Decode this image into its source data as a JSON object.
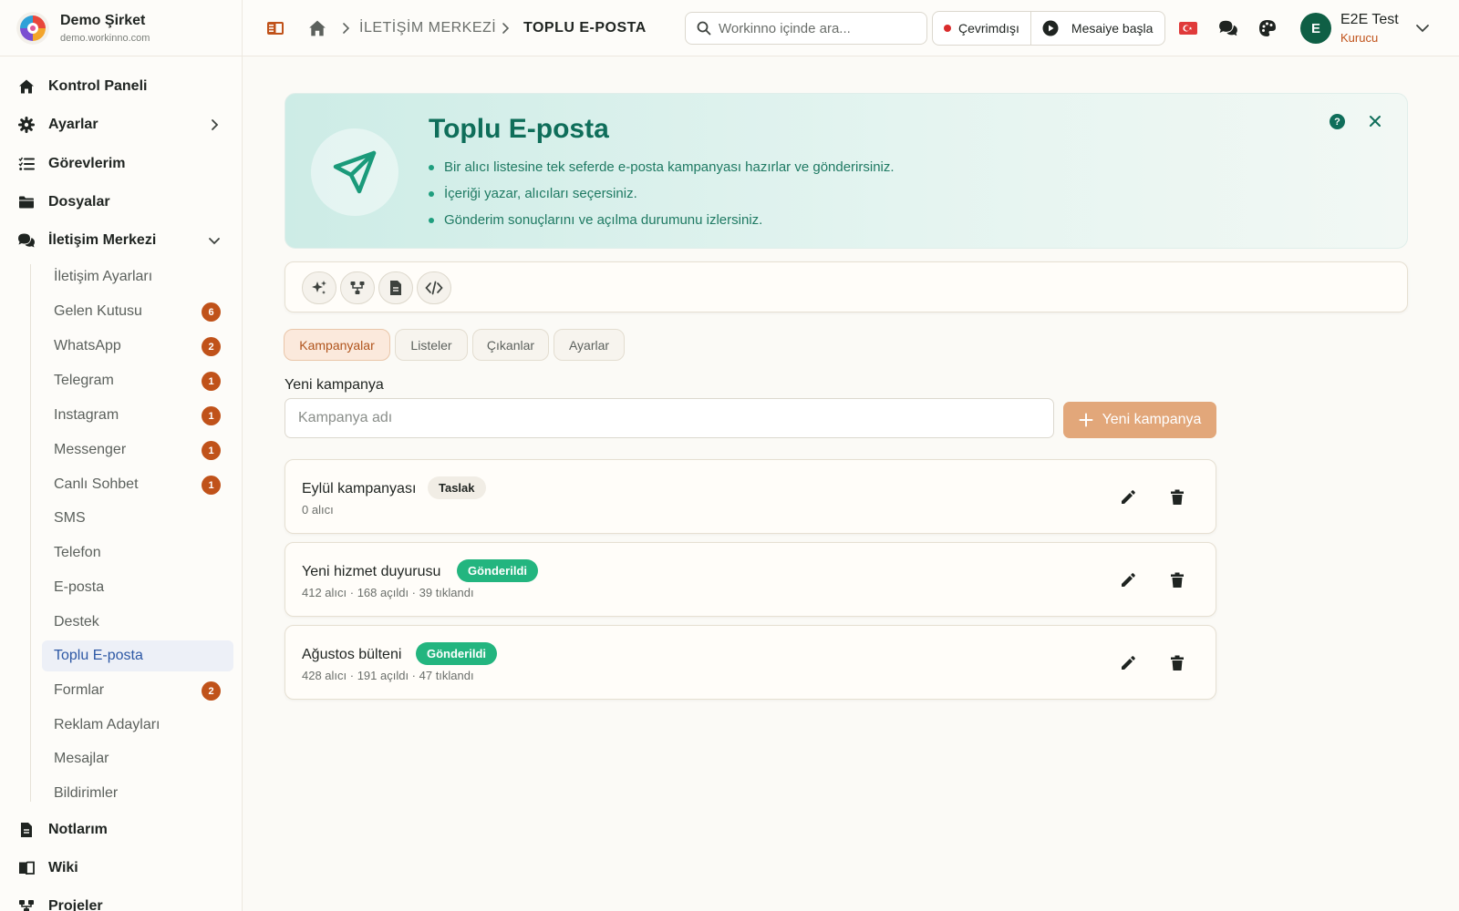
{
  "brand": {
    "name": "Demo Şirket",
    "domain": "demo.workinno.com"
  },
  "sidebar": {
    "main_items": [
      {
        "label": "Kontrol Paneli",
        "icon": "home-icon"
      },
      {
        "label": "Ayarlar",
        "icon": "gear-icon",
        "chevron": "right"
      },
      {
        "label": "Görevlerim",
        "icon": "tasks-icon"
      },
      {
        "label": "Dosyalar",
        "icon": "folder-icon"
      },
      {
        "label": "İletişim Merkezi",
        "icon": "chat-icon",
        "chevron": "down",
        "expanded": true
      }
    ],
    "sub_items": [
      {
        "label": "İletişim Ayarları"
      },
      {
        "label": "Gelen Kutusu",
        "badge": "6"
      },
      {
        "label": "WhatsApp",
        "badge": "2"
      },
      {
        "label": "Telegram",
        "badge": "1"
      },
      {
        "label": "Instagram",
        "badge": "1"
      },
      {
        "label": "Messenger",
        "badge": "1"
      },
      {
        "label": "Canlı Sohbet",
        "badge": "1"
      },
      {
        "label": "SMS"
      },
      {
        "label": "Telefon"
      },
      {
        "label": "E-posta"
      },
      {
        "label": "Destek"
      },
      {
        "label": "Toplu E-posta",
        "active": true
      },
      {
        "label": "Formlar",
        "badge": "2"
      },
      {
        "label": "Reklam Adayları"
      },
      {
        "label": "Mesajlar"
      },
      {
        "label": "Bildirimler"
      }
    ],
    "bottom_items": [
      {
        "label": "Notlarım",
        "icon": "note-icon"
      },
      {
        "label": "Wiki",
        "icon": "book-icon"
      },
      {
        "label": "Projeler",
        "icon": "projects-icon"
      }
    ],
    "badge_color": "#c0521a"
  },
  "header": {
    "breadcrumb": {
      "parent": "İLETİŞİM MERKEZİ",
      "current": "TOPLU E-POSTA"
    },
    "search_placeholder": "Workinno içinde ara...",
    "status_label": "Çevrimdışı",
    "shift_label": "Mesaiye başla",
    "user": {
      "initial": "E",
      "name": "E2E Test",
      "role": "Kurucu"
    }
  },
  "hero": {
    "title": "Toplu E-posta",
    "bullets": [
      "Bir alıcı listesine tek seferde e-posta kampanyası hazırlar ve gönderirsiniz.",
      "İçeriği yazar, alıcıları seçersiniz.",
      "Gönderim sonuçlarını ve açılma durumunu izlersiniz."
    ],
    "help_glyph": "?",
    "accent_color": "#0f6e5a"
  },
  "toolbar": {
    "tools": [
      "sparkles-icon",
      "workflow-icon",
      "document-icon",
      "code-icon"
    ]
  },
  "tabs": [
    {
      "label": "Kampanyalar",
      "active": true
    },
    {
      "label": "Listeler"
    },
    {
      "label": "Çıkanlar"
    },
    {
      "label": "Ayarlar"
    }
  ],
  "new_campaign": {
    "label": "Yeni kampanya",
    "placeholder": "Kampanya adı",
    "button_label": "Yeni kampanya",
    "button_color": "#e2a77a"
  },
  "campaigns": [
    {
      "name": "Eylül kampanyası",
      "status": "Taslak",
      "status_type": "draft",
      "meta": "0 alıcı"
    },
    {
      "name": "Yeni hizmet duyurusu",
      "status": "Gönderildi",
      "status_type": "sent",
      "meta": "412 alıcı · 168 açıldı · 39 tıklandı"
    },
    {
      "name": "Ağustos bülteni",
      "status": "Gönderildi",
      "status_type": "sent",
      "meta": "428 alıcı · 191 açıldı · 47 tıklandı"
    }
  ],
  "status_colors": {
    "sent": "#23b57f",
    "offline": "#d92b2b"
  }
}
